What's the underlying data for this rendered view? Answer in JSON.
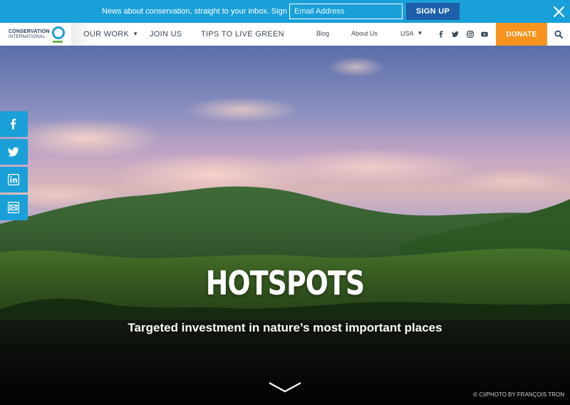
{
  "signup": {
    "text": "News about conservation, straight to your inbox. Sign up now.",
    "email_placeholder": "Email Address",
    "button_label": "SIGN UP"
  },
  "nav": {
    "logo_line1": "CONSERVATION",
    "logo_line2": "INTERNATIONAL",
    "our_work": "OUR WORK",
    "join_us": "JOIN US",
    "tips": "TIPS TO LIVE GREEN",
    "blog": "Blog",
    "about": "About Us",
    "region": "USA",
    "donate": "DONATE",
    "social_icons": [
      "facebook-icon",
      "twitter-icon",
      "instagram-icon",
      "youtube-icon"
    ]
  },
  "hero": {
    "title": "HOTSPOTS",
    "subtitle": "Targeted investment in nature’s most important places",
    "credit": "© CI/PHOTO BY FRANÇOIS TRON"
  },
  "share": {
    "icons": [
      "facebook-icon",
      "twitter-icon",
      "linkedin-icon",
      "email-icon"
    ]
  },
  "colors": {
    "accent_blue": "#1aa0d8",
    "signup_button": "#1d5fa8",
    "donate_orange": "#f7941d",
    "logo_green": "#6bb34a"
  }
}
